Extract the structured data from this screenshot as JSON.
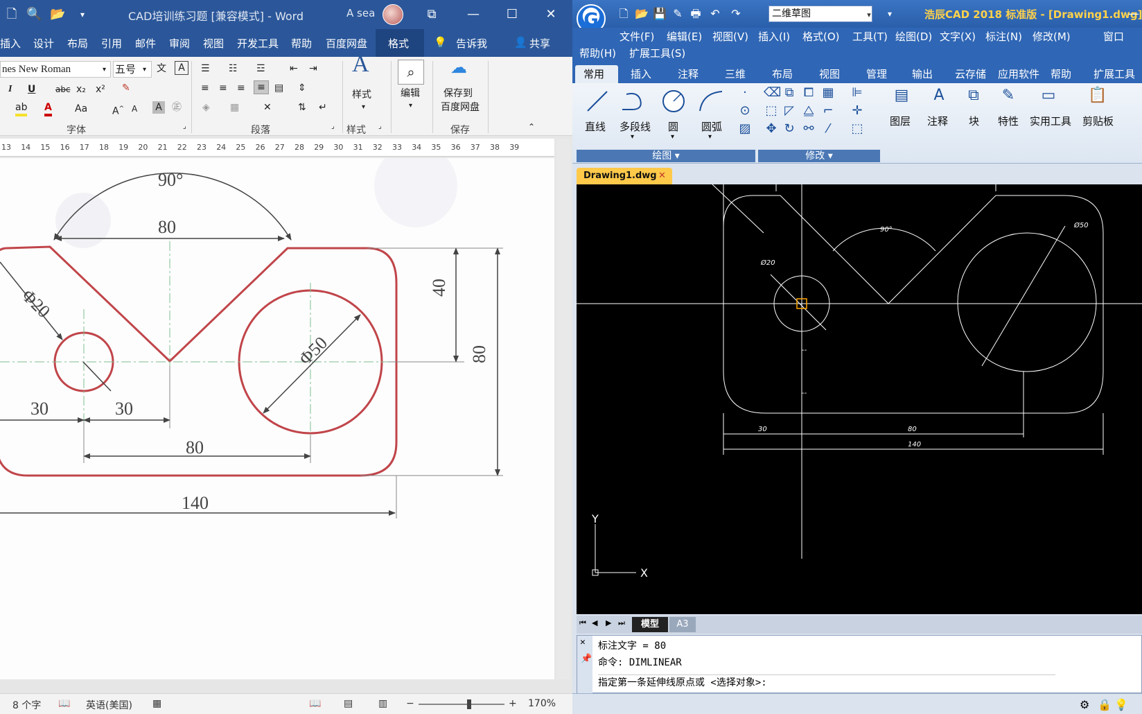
{
  "word": {
    "title": "CAD培训练习题 [兼容模式]  -  Word",
    "user": "A sea",
    "tabs": [
      "插入",
      "设计",
      "布局",
      "引用",
      "邮件",
      "审阅",
      "视图",
      "开发工具",
      "帮助",
      "百度网盘",
      "格式",
      "告诉我",
      "共享"
    ],
    "font_name": "nes New Roman",
    "font_size": "五号",
    "groups": [
      "字体",
      "段落",
      "样式",
      "保存"
    ],
    "styles_label": "样式",
    "edit_label": "编辑",
    "save_baidu_label_1": "保存到",
    "save_baidu_label_2": "百度网盘",
    "ruler": [
      "13",
      "14",
      "15",
      "16",
      "17",
      "18",
      "19",
      "20",
      "21",
      "22",
      "23",
      "24",
      "25",
      "26",
      "27",
      "28",
      "29",
      "30",
      "31",
      "32",
      "33",
      "34",
      "35",
      "36",
      "37",
      "38",
      "39"
    ],
    "drawing": {
      "angle": "90°",
      "d_top": "80",
      "dia_small": "Φ20",
      "dia_large": "Φ50",
      "d_30a": "30",
      "d_30b": "30",
      "d_80_bottom": "80",
      "d_140": "140",
      "d_40": "40",
      "d_80_right": "80"
    },
    "status": {
      "word_count": "8 个字",
      "language": "英语(美国)",
      "zoom": "170%"
    }
  },
  "cad": {
    "workspace": "二维草图",
    "app_title": "浩辰CAD 2018 标准版 - [Drawing1.dwg]",
    "menus": [
      "文件(F)",
      "编辑(E)",
      "视图(V)",
      "插入(I)",
      "格式(O)",
      "工具(T)",
      "绘图(D)",
      "文字(X)",
      "标注(N)",
      "修改(M)",
      "窗口",
      "帮助(H)",
      "扩展工具(S)"
    ],
    "ribbon_tabs": [
      "常用",
      "插入",
      "注释",
      "三维",
      "布局",
      "视图",
      "管理",
      "输出",
      "云存储",
      "应用软件",
      "帮助",
      "扩展工具"
    ],
    "draw_buttons": [
      "直线",
      "多段线",
      "圆",
      "圆弧"
    ],
    "right_buttons": [
      "图层",
      "注释",
      "块",
      "特性",
      "实用工具",
      "剪贴板"
    ],
    "group_draw": "绘图",
    "group_modify": "修改",
    "doc_tab": "Drawing1.dwg",
    "layout_tabs": [
      "模型",
      "A3"
    ],
    "canvas": {
      "angle": "90°",
      "dia_small": "Ø20",
      "dia_large": "Ø50",
      "d_30": "30",
      "d_80": "80",
      "d_140": "140",
      "axis_y": "Y",
      "axis_x": "X"
    },
    "command_lines": [
      "标注文字 = 80",
      "命令: DIMLINEAR",
      "指定第一条延伸线原点或 <选择对象>:"
    ]
  }
}
